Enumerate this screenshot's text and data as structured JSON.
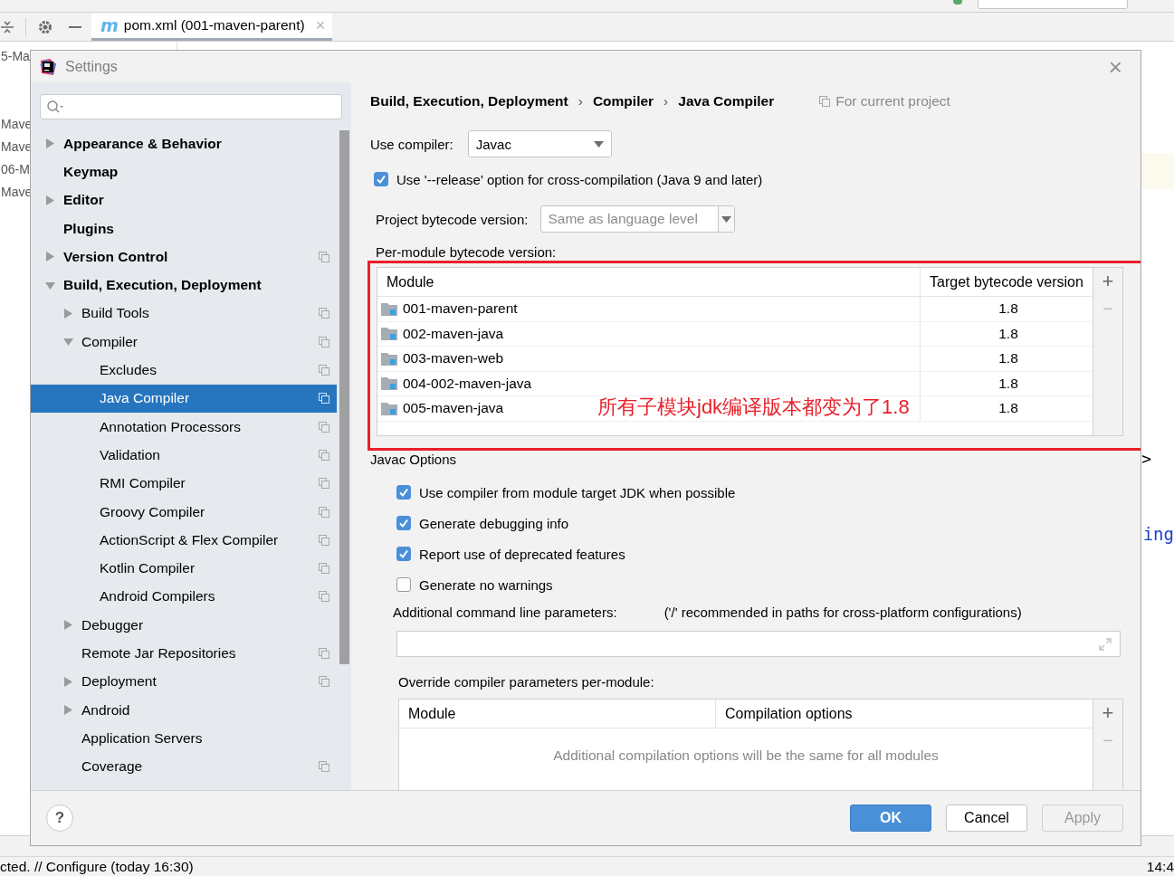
{
  "ide": {
    "tab": {
      "icon_text": "m",
      "label": "pom.xml (001-maven-parent)",
      "close": "×"
    },
    "project_tree": [
      "5-Ma",
      "Mave",
      "Mave",
      "06-M",
      "Mave"
    ],
    "editor": {
      "text": "ing",
      "mark": ">"
    },
    "status": "cted. // Configure (today 16:30)",
    "status_right": "14:4"
  },
  "dialog": {
    "title": "Settings",
    "close": "×",
    "tree": [
      {
        "label": "Appearance & Behavior",
        "expanded": false,
        "selected": false
      },
      {
        "label": "Keymap",
        "selected": false
      },
      {
        "label": "Editor",
        "expanded": false,
        "selected": false
      },
      {
        "label": "Plugins",
        "selected": false
      },
      {
        "label": "Version Control",
        "expanded": false,
        "selected": false,
        "project_scope": true
      },
      {
        "label": "Build, Execution, Deployment",
        "expanded": true,
        "selected": false,
        "children": [
          {
            "label": "Build Tools",
            "expanded": false,
            "selected": false,
            "project_scope": true
          },
          {
            "label": "Compiler",
            "expanded": true,
            "selected": false,
            "project_scope": true,
            "children": [
              {
                "label": "Excludes",
                "selected": false,
                "project_scope": true
              },
              {
                "label": "Java Compiler",
                "selected": true,
                "project_scope": true
              },
              {
                "label": "Annotation Processors",
                "selected": false,
                "project_scope": true
              },
              {
                "label": "Validation",
                "selected": false,
                "project_scope": true
              },
              {
                "label": "RMI Compiler",
                "selected": false,
                "project_scope": true
              },
              {
                "label": "Groovy Compiler",
                "selected": false,
                "project_scope": true
              },
              {
                "label": "ActionScript & Flex Compiler",
                "selected": false,
                "project_scope": true
              },
              {
                "label": "Kotlin Compiler",
                "selected": false,
                "project_scope": true
              },
              {
                "label": "Android Compilers",
                "selected": false,
                "project_scope": true
              }
            ]
          },
          {
            "label": "Debugger",
            "expanded": false,
            "selected": false
          },
          {
            "label": "Remote Jar Repositories",
            "selected": false,
            "project_scope": true
          },
          {
            "label": "Deployment",
            "expanded": false,
            "selected": false,
            "project_scope": true
          },
          {
            "label": "Android",
            "expanded": false,
            "selected": false
          },
          {
            "label": "Application Servers",
            "selected": false
          },
          {
            "label": "Coverage",
            "selected": false,
            "project_scope": true
          }
        ]
      }
    ],
    "breadcrumb": [
      "Build, Execution, Deployment",
      "Compiler",
      "Java Compiler"
    ],
    "breadcrumb_separator": "›",
    "scope_note": "For current project",
    "use_compiler": {
      "label": "Use compiler:",
      "value": "Javac"
    },
    "release_option": {
      "label": "Use '--release' option for cross-compilation (Java 9 and later)",
      "checked": true
    },
    "project_bytecode": {
      "label": "Project bytecode version:",
      "placeholder": "Same as language level"
    },
    "per_module_label": "Per-module bytecode version:",
    "module_table": {
      "columns": [
        "Module",
        "Target bytecode version"
      ],
      "add": "+",
      "remove": "−",
      "rows": [
        {
          "module": "001-maven-parent",
          "target": "1.8"
        },
        {
          "module": "002-maven-java",
          "target": "1.8"
        },
        {
          "module": "003-maven-web",
          "target": "1.8"
        },
        {
          "module": "004-002-maven-java",
          "target": "1.8"
        },
        {
          "module": "005-maven-java",
          "target": "1.8"
        }
      ]
    },
    "annotation": "所有子模块jdk编译版本都变为了1.8",
    "javac_options_label": "Javac Options",
    "options": [
      {
        "label": "Use compiler from module target JDK when possible",
        "checked": true
      },
      {
        "label": "Generate debugging info",
        "checked": true
      },
      {
        "label": "Report use of deprecated features",
        "checked": true
      },
      {
        "label": "Generate no warnings",
        "checked": false
      }
    ],
    "additional_params": {
      "label": "Additional command line parameters:",
      "hint": "('/' recommended in paths for cross-platform configurations)"
    },
    "override_label": "Override compiler parameters per-module:",
    "override_table": {
      "columns": [
        "Module",
        "Compilation options"
      ],
      "empty_text": "Additional compilation options will be the same for all modules",
      "add": "+",
      "remove": "−"
    },
    "help": "?",
    "buttons": [
      {
        "label": "OK",
        "kind": "primary",
        "disabled": false
      },
      {
        "label": "Cancel",
        "kind": "normal",
        "disabled": false
      },
      {
        "label": "Apply",
        "kind": "normal",
        "disabled": true
      }
    ]
  }
}
